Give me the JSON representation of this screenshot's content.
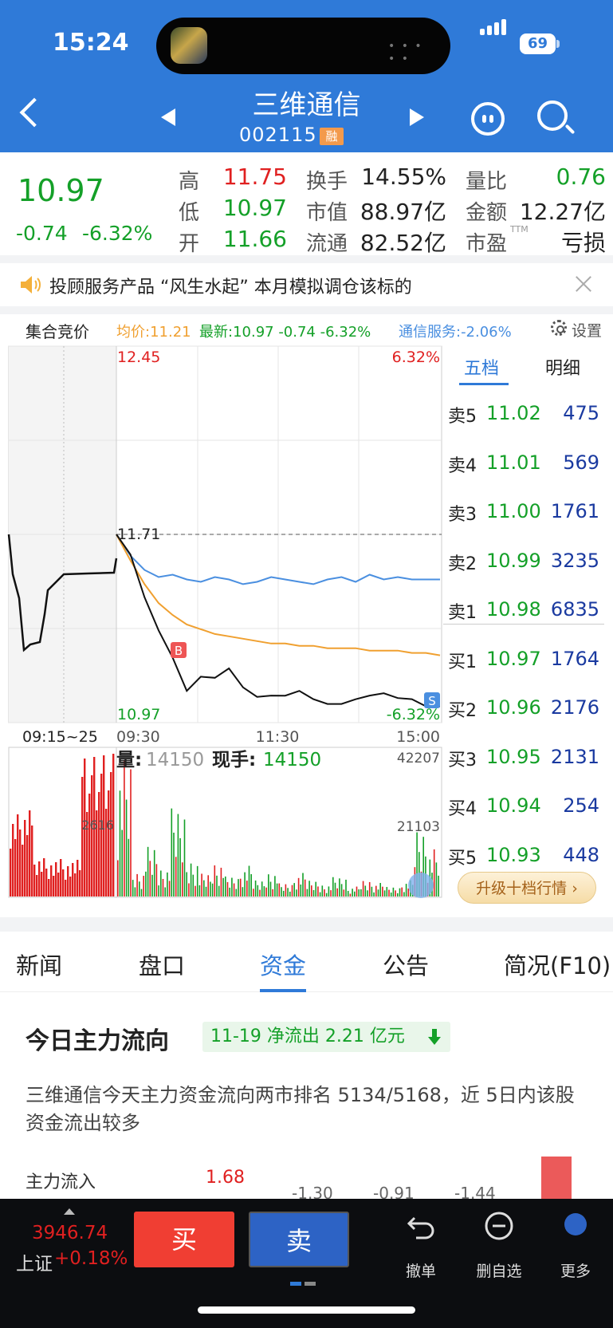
{
  "status": {
    "time": "15:24",
    "battery": "69"
  },
  "nav": {
    "title": "三维通信",
    "code": "002115",
    "badge": "融"
  },
  "quote": {
    "price": "10.97",
    "change": "-0.74",
    "pct": "-6.32%",
    "stats": [
      {
        "label": "高",
        "value": "11.75",
        "color": "red"
      },
      {
        "label": "低",
        "value": "10.97",
        "color": "green"
      },
      {
        "label": "开",
        "value": "11.66",
        "color": "green"
      },
      {
        "label": "换手",
        "value": "14.55%",
        "color": "dark"
      },
      {
        "label": "市值",
        "value": "88.97亿",
        "color": "dark"
      },
      {
        "label": "流通",
        "value": "82.52亿",
        "color": "dark"
      },
      {
        "label": "量比",
        "value": "0.76",
        "color": "green"
      },
      {
        "label": "金额",
        "value": "12.27亿",
        "color": "dark"
      },
      {
        "label": "市盈",
        "value": "亏损",
        "color": "dark",
        "sup": "TTM"
      }
    ]
  },
  "notice": {
    "text": "投顾服务产品 “风生水起” 本月模拟调仓该标的"
  },
  "infobar": {
    "auction": "集合竞价",
    "avg": "均价:11.21",
    "latest": "最新:10.97  -0.74  -6.32%",
    "sector": "通信服务:-2.06%",
    "settings": "设置"
  },
  "chart": {
    "high_label": "12.45",
    "high_pct": "6.32%",
    "low_label": "10.97",
    "low_pct": "-6.32%",
    "ref_label": "11.71",
    "time_auction": "09:15~25",
    "time_start": "09:30",
    "time_mid": "11:30",
    "time_end": "15:00",
    "buy_marker": "B",
    "sell_marker": "S",
    "vol_label": "量:",
    "vol_value": "14150",
    "hand_label": "现手:",
    "hand_value": "14150",
    "vol_max": "42207",
    "vol_mid": "21103",
    "auction_vol": "2616"
  },
  "chart_data": {
    "type": "line",
    "y_range": [
      10.97,
      12.45
    ],
    "reference_price": 11.71,
    "x_ticks": [
      "09:30",
      "11:30",
      "15:00"
    ],
    "series": [
      {
        "name": "price",
        "values": [
          11.71,
          11.62,
          11.45,
          11.32,
          11.18,
          11.05,
          11.12,
          11.09,
          11.14,
          11.07,
          11.04,
          11.02,
          11.03,
          11.06,
          11.0,
          10.99,
          11.0,
          11.03,
          11.02,
          11.04,
          11.03,
          11.0,
          10.98,
          10.99
        ]
      },
      {
        "name": "avg",
        "values": [
          11.71,
          11.6,
          11.5,
          11.42,
          11.37,
          11.33,
          11.31,
          11.29,
          11.28,
          11.27,
          11.26,
          11.25,
          11.25,
          11.24,
          11.24,
          11.23,
          11.23,
          11.23,
          11.22,
          11.22,
          11.22,
          11.21,
          11.21,
          11.2
        ]
      },
      {
        "name": "sector",
        "values": [
          11.71,
          11.62,
          11.56,
          11.53,
          11.54,
          11.52,
          11.51,
          11.53,
          11.52,
          11.5,
          11.51,
          11.53,
          11.52,
          11.51,
          11.5,
          11.52,
          11.53,
          11.51,
          11.54,
          11.52,
          11.53,
          11.52,
          11.52,
          11.52
        ]
      }
    ],
    "volume": [
      42207,
      8000,
      15000,
      9000,
      26000,
      12000,
      7000,
      11000,
      6000,
      9000,
      5000,
      8000,
      4000,
      7000,
      5000,
      4000,
      6000,
      3000,
      5000,
      4000,
      3000,
      5000,
      21103,
      14150
    ]
  },
  "orderbook": {
    "tabs": [
      "五档",
      "明细"
    ],
    "asks": [
      {
        "label": "卖5",
        "price": "11.02",
        "vol": "475"
      },
      {
        "label": "卖4",
        "price": "11.01",
        "vol": "569"
      },
      {
        "label": "卖3",
        "price": "11.00",
        "vol": "1761"
      },
      {
        "label": "卖2",
        "price": "10.99",
        "vol": "3235"
      },
      {
        "label": "卖1",
        "price": "10.98",
        "vol": "6835"
      }
    ],
    "bids": [
      {
        "label": "买1",
        "price": "10.97",
        "vol": "1764"
      },
      {
        "label": "买2",
        "price": "10.96",
        "vol": "2176"
      },
      {
        "label": "买3",
        "price": "10.95",
        "vol": "2131"
      },
      {
        "label": "买4",
        "price": "10.94",
        "vol": "254"
      },
      {
        "label": "买5",
        "price": "10.93",
        "vol": "448"
      }
    ],
    "upgrade": "升级十档行情 ›"
  },
  "tabs": [
    "新闻",
    "盘口",
    "资金",
    "公告",
    "简况(F10)"
  ],
  "flow": {
    "title": "今日主力流向",
    "badge": "11-19 净流出 2.21 亿元",
    "desc": "三维通信今天主力资金流向两市排名 5134/5168，近 5日内该股资金流出较多",
    "row_label": "主力流入",
    "row_value": "1.68",
    "bar_values": [
      "-1.30",
      "-0.91",
      "-1.44"
    ]
  },
  "bottombar": {
    "index_value": "3946.74",
    "index_name": "上证",
    "index_change": "+0.18%",
    "buy": "买",
    "sell": "卖",
    "items": [
      "撤单",
      "删自选",
      "更多"
    ]
  },
  "colors": {
    "brand": "#2f7ad8",
    "up": "#e02020",
    "down": "#14a028",
    "avg": "#f0a030",
    "sector": "#4a8fe0"
  }
}
